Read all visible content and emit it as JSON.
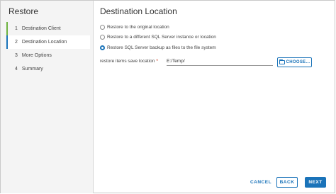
{
  "wizard": {
    "title": "Restore",
    "steps": [
      {
        "num": "1",
        "label": "Destination Client"
      },
      {
        "num": "2",
        "label": "Destination Location"
      },
      {
        "num": "3",
        "label": "More Options"
      },
      {
        "num": "4",
        "label": "Summary"
      }
    ],
    "current_step": 2
  },
  "content": {
    "title": "Destination Location",
    "options": [
      {
        "label": "Restore to the original location",
        "checked": false
      },
      {
        "label": "Restore to a different SQL Server instance or location",
        "checked": false
      },
      {
        "label": "Restore SQL Server backup as files to the file system",
        "checked": true
      }
    ],
    "path": {
      "label": "restore items save location",
      "required_mark": "*",
      "value": "E:/Temp/"
    },
    "choose_label": "CHOOSE..."
  },
  "footer": {
    "cancel_label": "CANCEL",
    "back_label": "BACK",
    "next_label": "NEXT"
  },
  "colors": {
    "accent": "#1a73b9",
    "done_step": "#6db33f",
    "required": "#c21d00"
  }
}
